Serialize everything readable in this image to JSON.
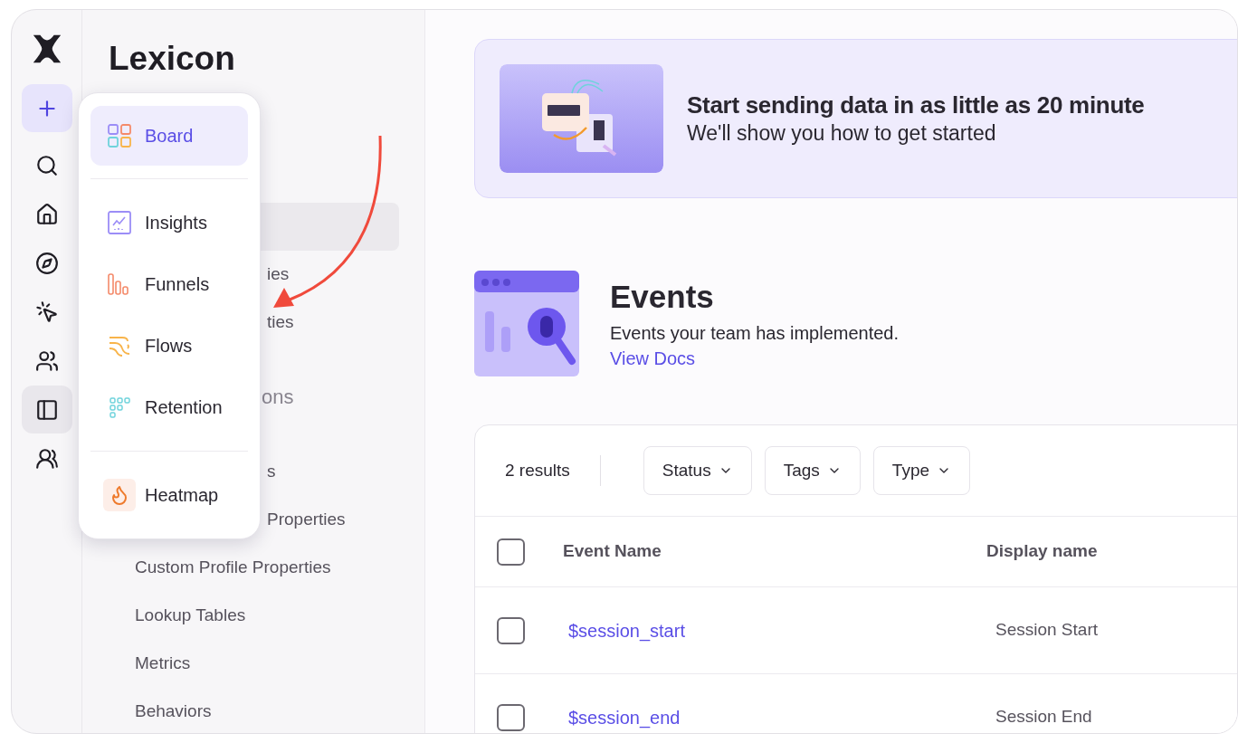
{
  "rail": {
    "items": [
      {
        "kind": "logo"
      },
      {
        "kind": "plus",
        "selected": true
      },
      {
        "kind": "search",
        "selected": false
      },
      {
        "kind": "home",
        "selected": false
      },
      {
        "kind": "compass",
        "selected": false
      },
      {
        "kind": "click",
        "selected": false
      },
      {
        "kind": "users",
        "selected": false
      },
      {
        "kind": "panel",
        "selected": true
      },
      {
        "kind": "group",
        "selected": false
      }
    ]
  },
  "sidebar": {
    "title": "Lexicon",
    "items": [
      {
        "kind": "item",
        "selected": true
      },
      {
        "kind": "cut",
        "label": "ies",
        "selected": false
      },
      {
        "kind": "cut",
        "label": "ties",
        "selected": false
      },
      {
        "kind": "header",
        "label": "ons"
      },
      {
        "kind": "cut",
        "label": "s",
        "selected": false
      },
      {
        "kind": "cut",
        "label": "Properties",
        "selected": false
      },
      {
        "kind": "item",
        "label": "Custom Profile Properties",
        "selected": false
      },
      {
        "kind": "item",
        "label": "Lookup Tables",
        "selected": false
      },
      {
        "kind": "item",
        "label": "Metrics",
        "selected": false
      },
      {
        "kind": "item",
        "label": "Behaviors",
        "selected": false
      }
    ]
  },
  "menu": {
    "groups": [
      [
        {
          "kind": "board",
          "label": "Board",
          "selected": true
        }
      ],
      [
        {
          "kind": "insights",
          "label": "Insights",
          "selected": false
        },
        {
          "kind": "funnels",
          "label": "Funnels",
          "selected": false
        },
        {
          "kind": "flows",
          "label": "Flows",
          "selected": false
        },
        {
          "kind": "retention",
          "label": "Retention",
          "selected": false
        }
      ],
      [
        {
          "kind": "heatmap",
          "label": "Heatmap",
          "selected": false
        }
      ]
    ]
  },
  "banner": {
    "title": "Start sending data in as little as 20 minute",
    "subtitle": "We'll show you how to get started"
  },
  "events": {
    "title": "Events",
    "description": "Events your team has implemented.",
    "link": "View Docs"
  },
  "table": {
    "count": "2 results",
    "filters": [
      "Status",
      "Tags",
      "Type"
    ],
    "columns": [
      "Event Name",
      "Display name"
    ],
    "header_checked": false,
    "rows": [
      {
        "name": "$session_start",
        "display": "Session Start",
        "checked": false
      },
      {
        "name": "$session_end",
        "display": "Session End",
        "checked": false
      }
    ]
  }
}
